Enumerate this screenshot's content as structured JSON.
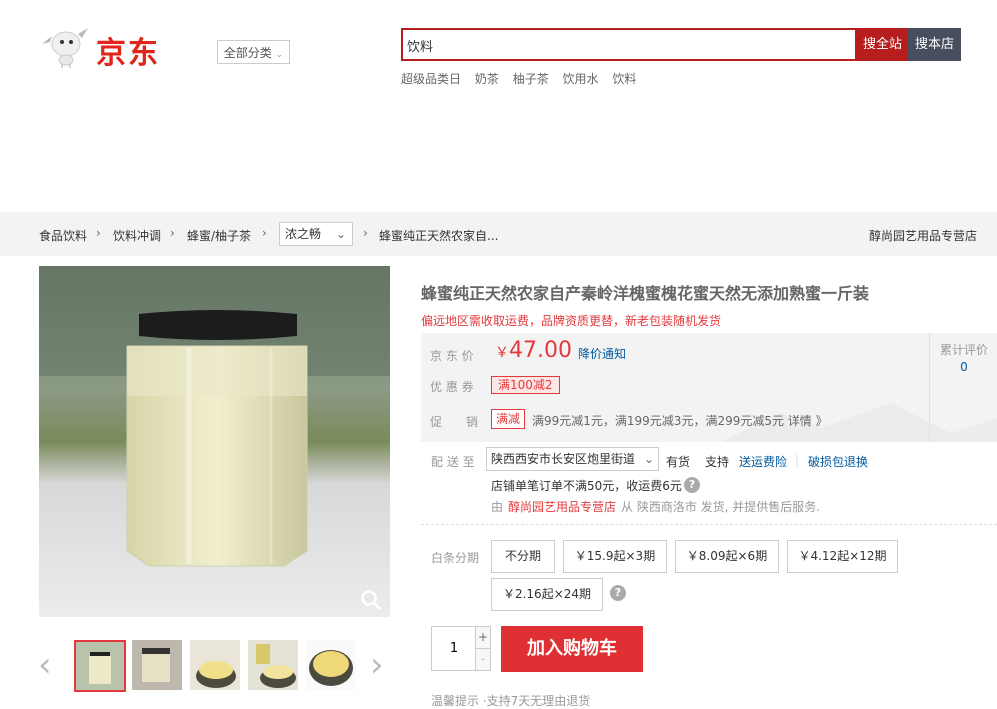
{
  "header": {
    "logo_text": "京东",
    "category_button": "全部分类",
    "search_value": "饮料",
    "search_all": "搜全站",
    "search_shop": "搜本店",
    "hot_words": [
      "超级品类日",
      "奶茶",
      "柚子茶",
      "饮用水",
      "饮料"
    ]
  },
  "breadcrumb": {
    "items": [
      "食品饮料",
      "饮料冲调",
      "蜂蜜/柚子茶"
    ],
    "brand_select": "浓之畅",
    "current": "蜂蜜纯正天然农家自...",
    "store": "醇尚园艺用品专营店"
  },
  "product": {
    "title": "蜂蜜纯正天然农家自产秦岭洋槐蜜槐花蜜天然无添加熟蜜一斤装",
    "subtitle": "偏远地区需收取运费，品牌资质更替，新老包装随机发货",
    "price_label": "京 东 价",
    "currency": "￥",
    "price": "47.00",
    "notify": "降价通知",
    "review_label": "累计评价",
    "review_count": "0",
    "coupon_label": "优 惠 券",
    "coupon": "满100减2",
    "promo_label": "促　　销",
    "promo_tag": "满减",
    "promo_text": "满99元减1元，满199元减3元，满299元减5元 详情 》"
  },
  "delivery": {
    "label": "配 送 至",
    "address": "陕西西安市长安区炮里街道",
    "stock": "有货",
    "support": "支持",
    "service1": "送运费险",
    "divider": "|",
    "service2": "破损包退换",
    "freight": "店铺单笔订单不满50元，收运费6元",
    "from_prefix": "由",
    "from_store": "醇尚园艺用品专营店",
    "from_suffix": "从 陕西商洛市 发货, 并提供售后服务."
  },
  "installment": {
    "label": "白条分期",
    "plans": [
      "不分期",
      "￥15.9起×3期",
      "￥8.09起×6期",
      "￥4.12起×12期",
      "￥2.16起×24期"
    ]
  },
  "purchase": {
    "quantity": "1",
    "plus": "+",
    "minus": "-",
    "cart_button": "加入购物车",
    "tips": "温馨提示 ·支持7天无理由退货"
  },
  "colors": {
    "jd_red": "#e1251b",
    "price_red": "#e4393c",
    "link_blue": "#005aa0",
    "search_dark": "#474e5d"
  }
}
